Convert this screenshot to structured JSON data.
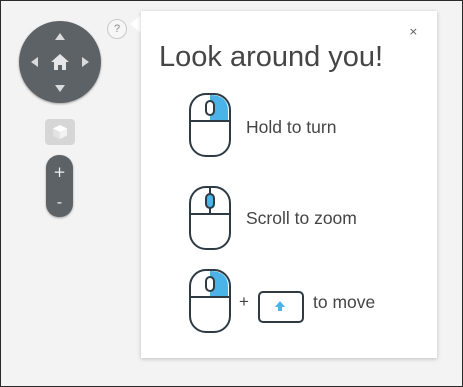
{
  "controls": {
    "nav_dial": {
      "icon": "home-icon"
    },
    "help_label": "?",
    "zoom_in_label": "+",
    "zoom_out_label": "-"
  },
  "panel": {
    "title": "Look around you!",
    "close_label": "×",
    "instructions": [
      {
        "label": "Hold to turn",
        "icon": "mouse-left-click-icon"
      },
      {
        "label": "Scroll to zoom",
        "icon": "mouse-scroll-icon"
      },
      {
        "label": "to move",
        "icon": "mouse-left-click-icon",
        "combo_symbol": "+",
        "key_icon": "arrow-up-key-icon"
      }
    ]
  },
  "colors": {
    "accent": "#4ab3e8",
    "mouse_outline": "#2e3b45",
    "control_dark": "#5d6266",
    "background": "#f3f3f3"
  }
}
